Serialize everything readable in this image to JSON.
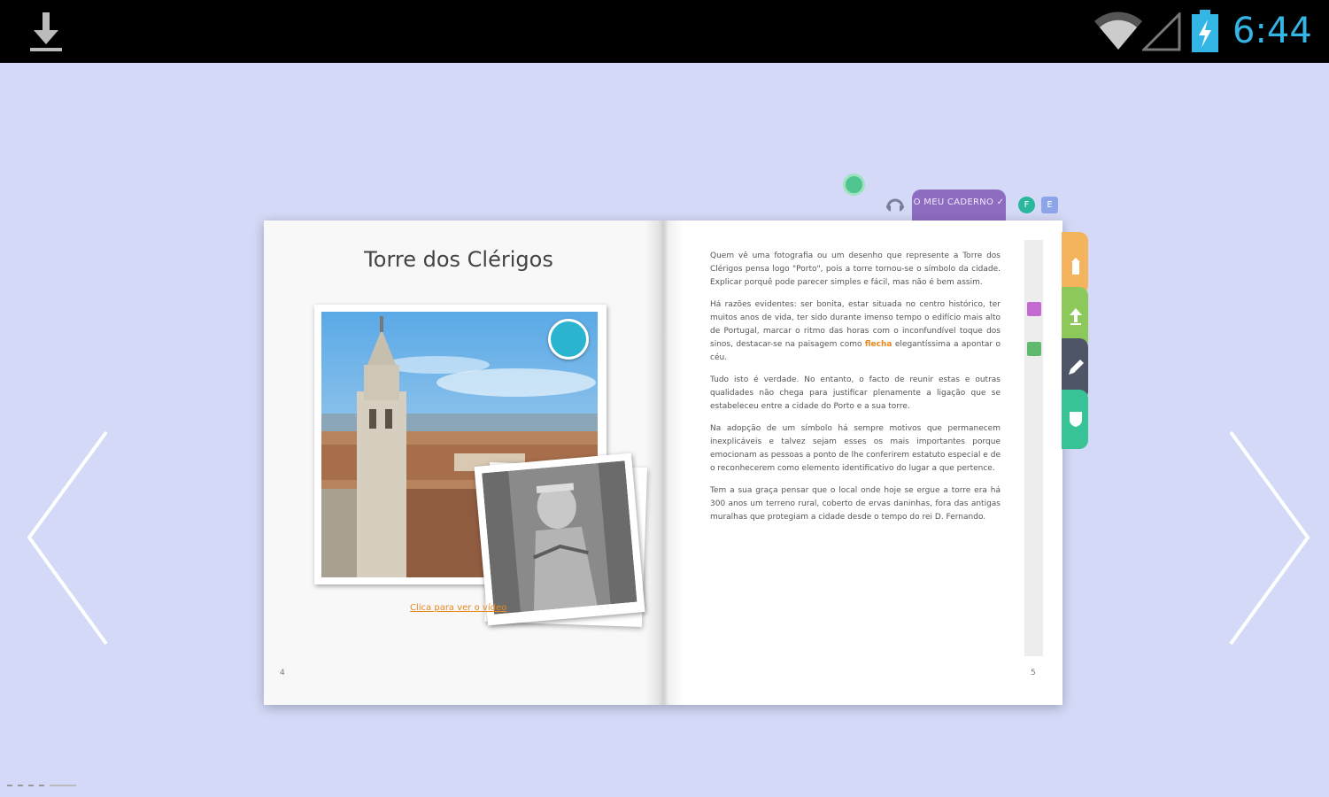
{
  "status_bar": {
    "time": "6:44",
    "icons": [
      "download-icon",
      "wifi-icon",
      "signal-icon",
      "battery-charging-icon"
    ],
    "time_color": "#33b5e5"
  },
  "toolbar": {
    "notebook_tab_label": "O MEU CADERNO ✓",
    "badge_green": "F",
    "badge_blue": "E",
    "icons": [
      "chat-icon",
      "headphones-icon"
    ]
  },
  "book": {
    "left_page": {
      "title": "Torre dos Clérigos",
      "video_link": "Clica para ver o vídeo",
      "page_number": "4"
    },
    "right_page": {
      "page_number": "5",
      "paragraphs": [
        "Quem vê uma fotografia ou um desenho que represente a Torre dos Clérigos pensa logo \"Porto\", pois a torre tornou-se o símbolo da cidade. Explicar porquê pode parecer simples e fácil, mas não é bem assim.",
        "Há razões evidentes: ser bonita, estar situada no centro histórico, ter muitos anos de vida, ter sido durante imenso tempo o edifício mais alto de Portugal, marcar o ritmo das horas com o inconfundível toque dos sinos, destacar-se na paisagem como",
        "Tudo isto é verdade. No entanto, o facto de reunir estas e outras qualidades não chega para justificar plenamente a ligação que se estabeleceu entre a cidade do Porto e a sua torre.",
        "Na adopção de um símbolo há sempre motivos que permanecem inexplicáveis e talvez sejam esses os mais importantes porque emocionam as pessoas a ponto de lhe conferirem estatuto especial e de o reconhecerem como elemento identificativo do lugar a que pertence.",
        "Tem a sua graça pensar que o local onde hoje se ergue a torre era há 300 anos um terreno rural, coberto de ervas daninhas, fora das antigas muralhas que protegiam a cidade desde o tempo do rei D. Fernando."
      ],
      "highlight_word": "flecha",
      "paragraph_2_tail": " elegantíssima a apontar o céu."
    }
  },
  "side_tabs": [
    "tower-icon",
    "upload-icon",
    "pen-icon",
    "shield-icon"
  ],
  "colors": {
    "background": "#d3d9f6",
    "accent_orange": "#e8871e",
    "notebook_purple": "#8e6cc0"
  }
}
